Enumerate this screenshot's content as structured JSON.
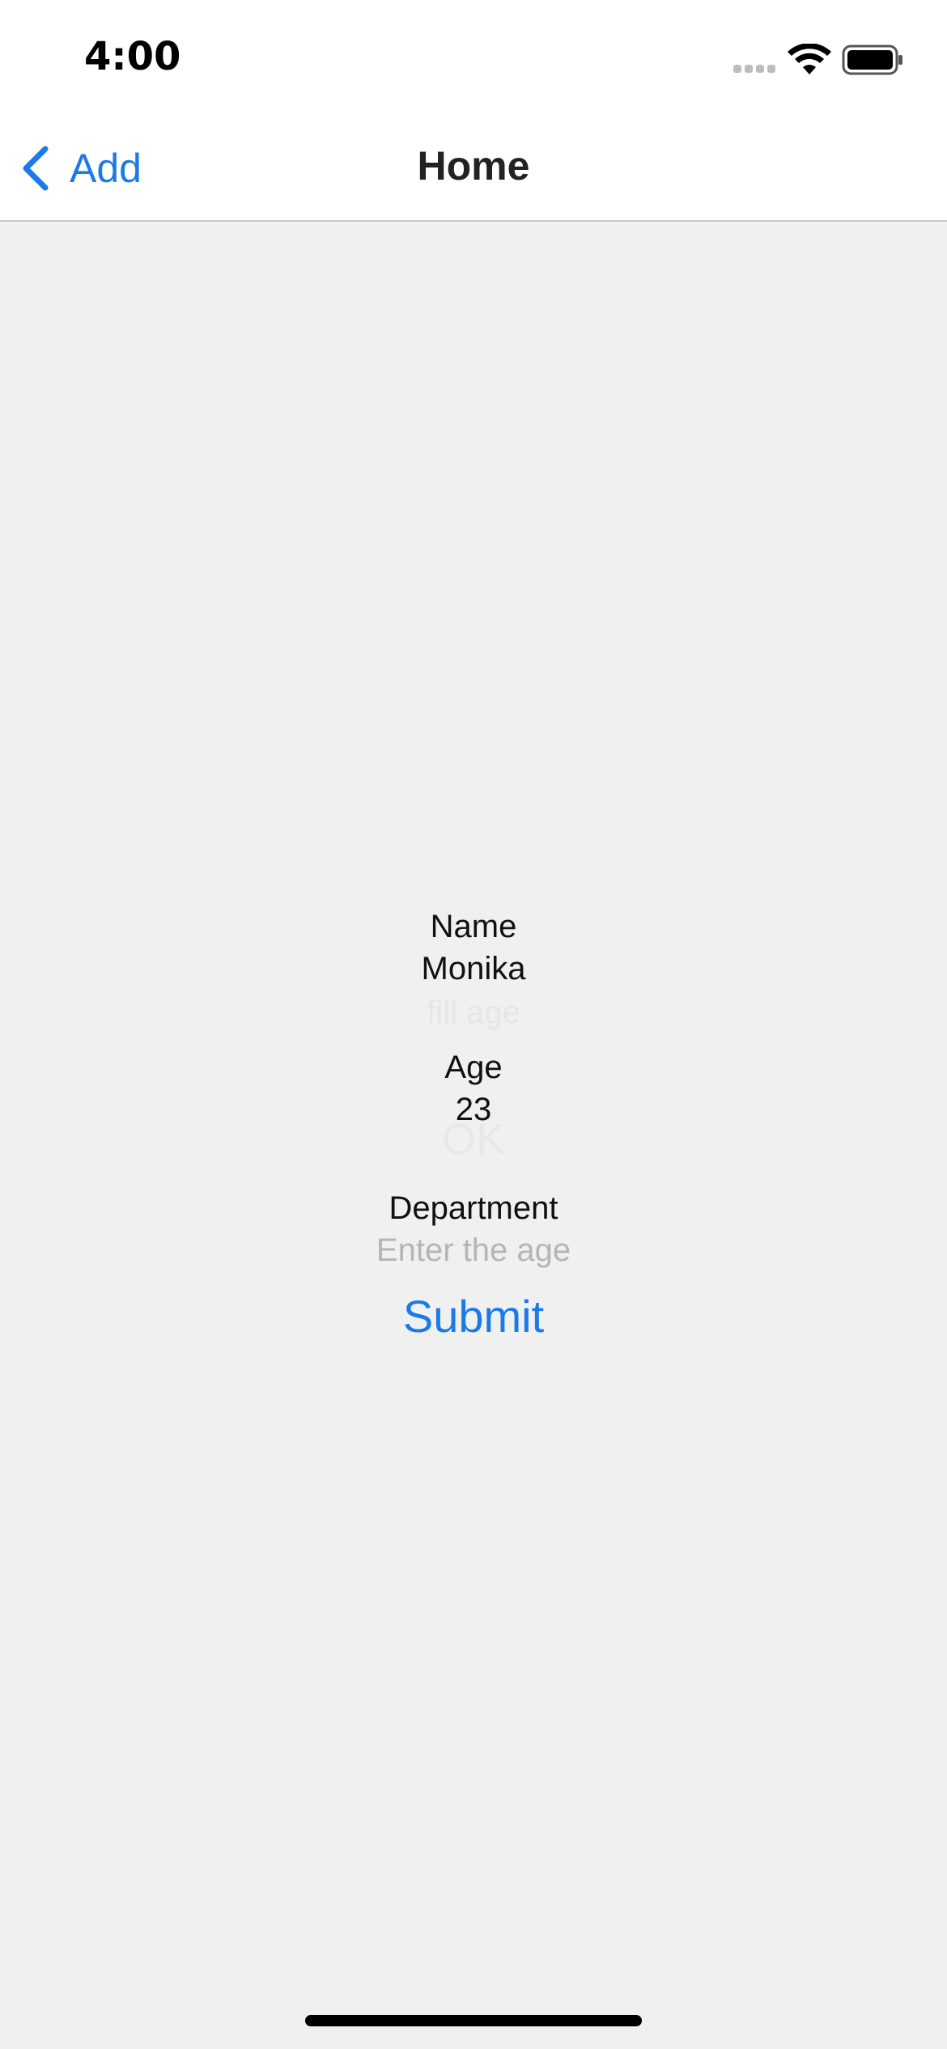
{
  "status_bar": {
    "time": "4:00",
    "icons": [
      "cellular-signal-icon",
      "wifi-icon",
      "battery-icon"
    ]
  },
  "nav": {
    "back_label": "Add",
    "title": "Home",
    "accent_color": "#1a7ae6"
  },
  "form": {
    "name_label": "Name",
    "name_value": "Monika",
    "name_hint": "fill age",
    "age_label": "Age",
    "age_value": "23",
    "ok_label": "OK",
    "department_label": "Department",
    "department_placeholder": "Enter the age",
    "submit_label": "Submit"
  }
}
